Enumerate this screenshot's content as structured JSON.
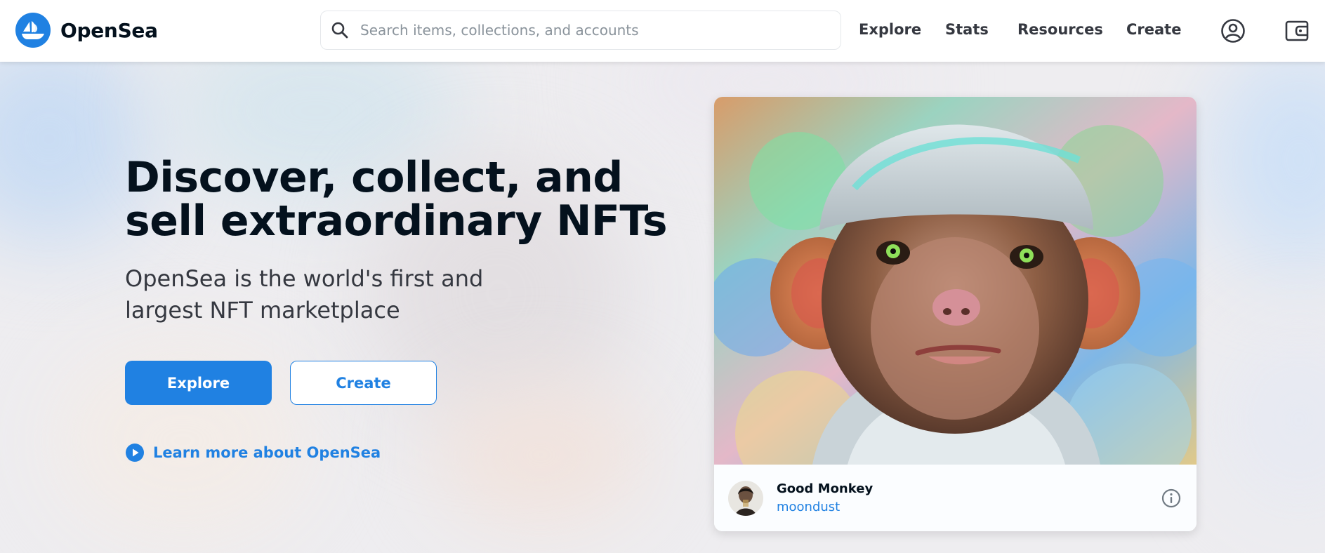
{
  "brand": {
    "name": "OpenSea",
    "logo_icon": "opensea-sailboat-icon",
    "color": "#2081e2"
  },
  "search": {
    "placeholder": "Search items, collections, and accounts",
    "icon": "search-icon"
  },
  "nav": {
    "links": [
      "Explore",
      "Stats",
      "Resources",
      "Create"
    ],
    "account_icon": "account-circle-icon",
    "wallet_icon": "wallet-icon"
  },
  "hero": {
    "title": "Discover, collect, and sell extraordinary NFTs",
    "subtitle": "OpenSea is the world's first and largest NFT marketplace",
    "primary_button": "Explore",
    "secondary_button": "Create",
    "learn_more": "Learn more about OpenSea"
  },
  "featured_nft": {
    "name": "Good Monkey",
    "creator": "moondust",
    "info_icon": "info-icon"
  }
}
